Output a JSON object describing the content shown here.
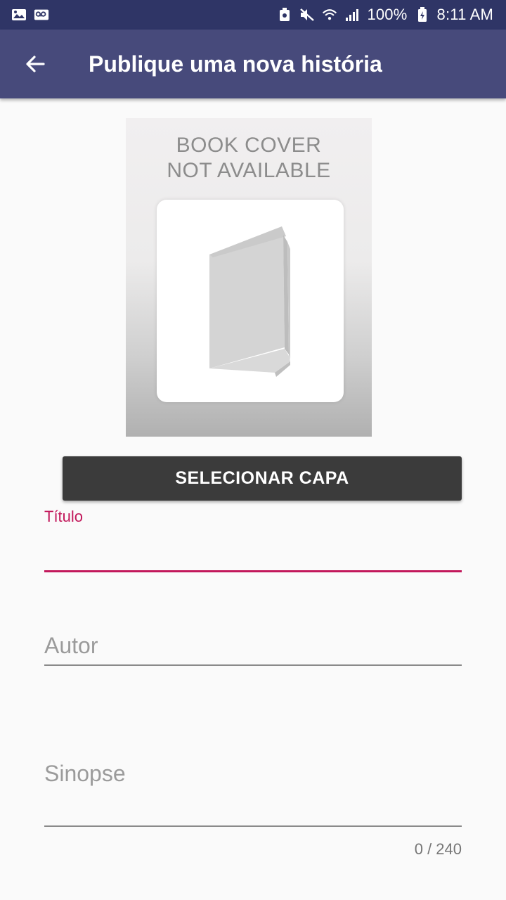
{
  "status_bar": {
    "battery_percent": "100%",
    "time": "8:11 AM",
    "icons_left": [
      "image-icon",
      "voicemail-icon"
    ],
    "icons_right": [
      "recycle-icon",
      "mute-icon",
      "wifi-icon",
      "signal-icon",
      "battery-charging-icon"
    ]
  },
  "app_bar": {
    "title": "Publique uma nova história",
    "back_icon": "arrow-back-icon"
  },
  "cover": {
    "line1": "BOOK COVER",
    "line2": "NOT AVAILABLE"
  },
  "select_button": "SELECIONAR CAPA",
  "form": {
    "titulo_label": "Título",
    "titulo_value": "",
    "autor_placeholder": "Autor",
    "sinopse_placeholder": "Sinopse",
    "sinopse_counter": "0 / 240"
  },
  "colors": {
    "status_bar": "#2f3566",
    "app_bar": "#474a7b",
    "accent": "#c2185b",
    "button": "#3b3b3b"
  }
}
